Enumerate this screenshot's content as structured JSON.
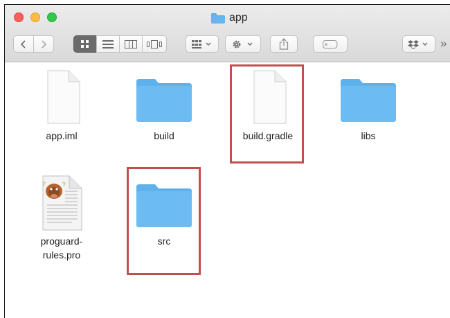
{
  "window": {
    "title": "app"
  },
  "toolbar": {
    "more_label": "»"
  },
  "files": [
    {
      "name": "app.iml",
      "type": "document"
    },
    {
      "name": "build",
      "type": "folder"
    },
    {
      "name": "build.gradle",
      "type": "document"
    },
    {
      "name": "libs",
      "type": "folder"
    },
    {
      "name": "proguard-\nrules.pro",
      "type": "proguard-document"
    },
    {
      "name": "src",
      "type": "folder"
    }
  ],
  "colors": {
    "highlight": "#c0504d",
    "folder": "#65b6ef",
    "close": "#fc605c",
    "minimize": "#fdbc40",
    "maximize": "#34c84a"
  },
  "highlighted_items": [
    "build.gradle",
    "src"
  ]
}
